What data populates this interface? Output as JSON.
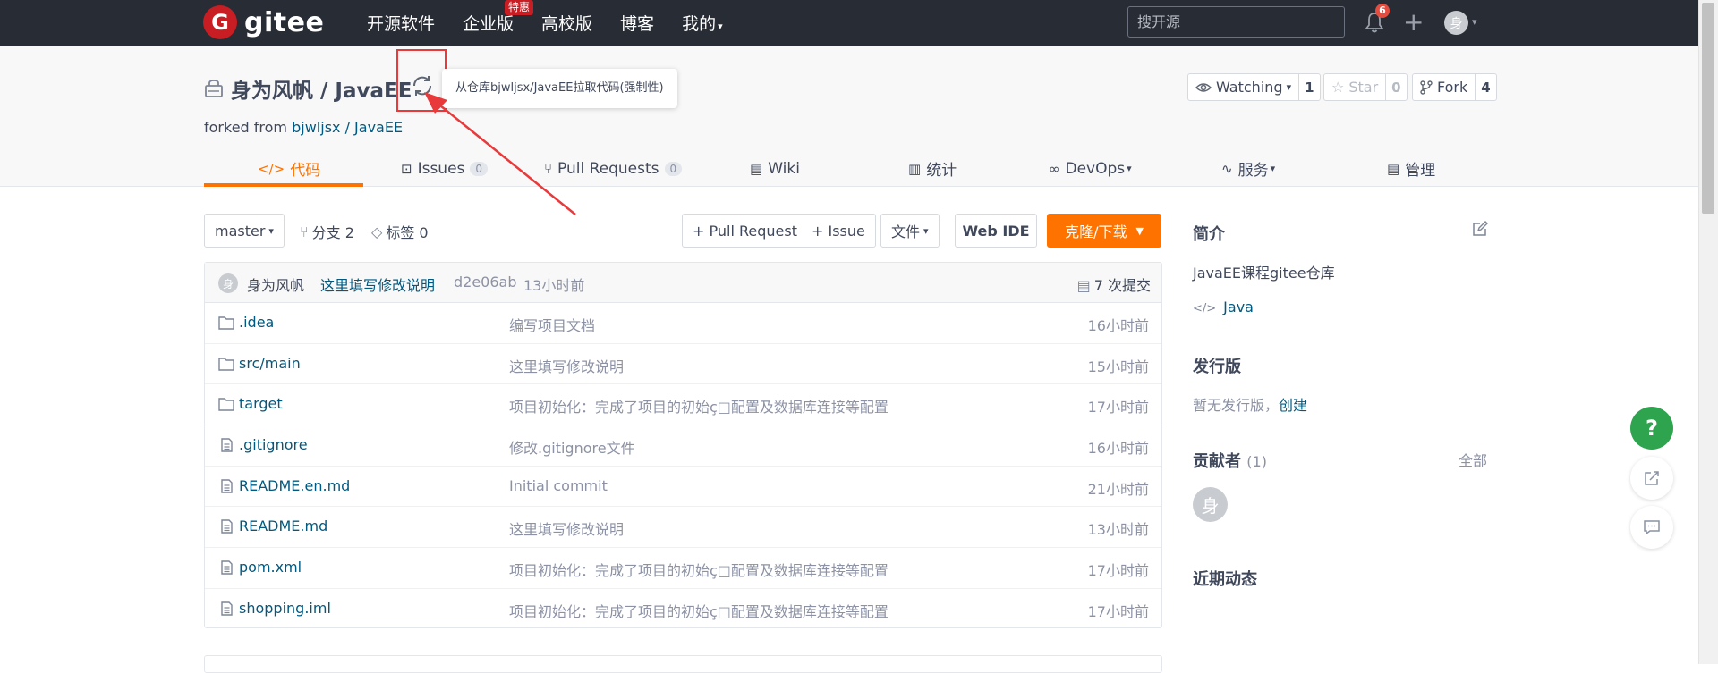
{
  "topbar": {
    "logo_mark": "G",
    "logo_text": "gitee",
    "nav": [
      {
        "label": "开源软件"
      },
      {
        "label": "企业版",
        "badge": "特惠"
      },
      {
        "label": "高校版"
      },
      {
        "label": "博客"
      },
      {
        "label": "我的"
      }
    ],
    "search_placeholder": "搜开源",
    "notification_count": "6",
    "plus_icon": "+",
    "avatar_initial": "身"
  },
  "repo": {
    "name": "身为风帆 / JavaEE",
    "sync_tooltip": "从仓库bjwljsx/JavaEE拉取代码(强制性)",
    "forked_prefix": "forked from",
    "forked_source": "bjwljsx / JavaEE",
    "watching_label": "Watching",
    "watching_count": "1",
    "star_label": "Star",
    "star_count": "0",
    "fork_label": "Fork",
    "fork_count": "4"
  },
  "tabs": [
    {
      "label": "代码",
      "icon": "</>"
    },
    {
      "label": "Issues",
      "count": "0"
    },
    {
      "label": "Pull Requests",
      "count": "0"
    },
    {
      "label": "Wiki"
    },
    {
      "label": "统计"
    },
    {
      "label": "DevOps"
    },
    {
      "label": "服务"
    },
    {
      "label": "管理"
    }
  ],
  "toolbar": {
    "branch": "master",
    "branches": "分支 2",
    "tags": "标签 0",
    "pull_request": "+ Pull Request",
    "issue": "+ Issue",
    "files": "文件",
    "web_ide": "Web IDE",
    "clone": "克隆/下载"
  },
  "commit": {
    "avatar": "身",
    "author": "身为风帆",
    "message": "这里填写修改说明",
    "hash": "d2e06ab",
    "time": "13小时前",
    "count": "7 次提交"
  },
  "files": [
    {
      "type": "folder",
      "name": ".idea",
      "message": "编写项目文档",
      "time": "16小时前"
    },
    {
      "type": "folder",
      "name": "src/main",
      "message": "这里填写修改说明",
      "time": "15小时前"
    },
    {
      "type": "folder",
      "name": "target",
      "message": "项目初始化：完成了项目的初始ç□配置及数据库连接等配置",
      "time": "17小时前"
    },
    {
      "type": "file",
      "name": ".gitignore",
      "message": "修改.gitignore文件",
      "time": "16小时前"
    },
    {
      "type": "file",
      "name": "README.en.md",
      "message": "Initial commit",
      "time": "21小时前"
    },
    {
      "type": "file",
      "name": "README.md",
      "message": "这里填写修改说明",
      "time": "13小时前"
    },
    {
      "type": "file",
      "name": "pom.xml",
      "message": "项目初始化：完成了项目的初始ç□配置及数据库连接等配置",
      "time": "17小时前"
    },
    {
      "type": "file",
      "name": "shopping.iml",
      "message": "项目初始化：完成了项目的初始ç□配置及数据库连接等配置",
      "time": "17小时前"
    }
  ],
  "sidebar": {
    "intro_title": "简介",
    "intro_text": "JavaEE课程gitee仓库",
    "language": "Java",
    "release_title": "发行版",
    "release_text": "暂无发行版，",
    "release_create": "创建",
    "contributors_title": "贡献者",
    "contributors_count": "(1)",
    "contributors_all": "全部",
    "contributor_avatar": "身",
    "activity_title": "近期动态"
  },
  "floating": {
    "help": "?"
  }
}
